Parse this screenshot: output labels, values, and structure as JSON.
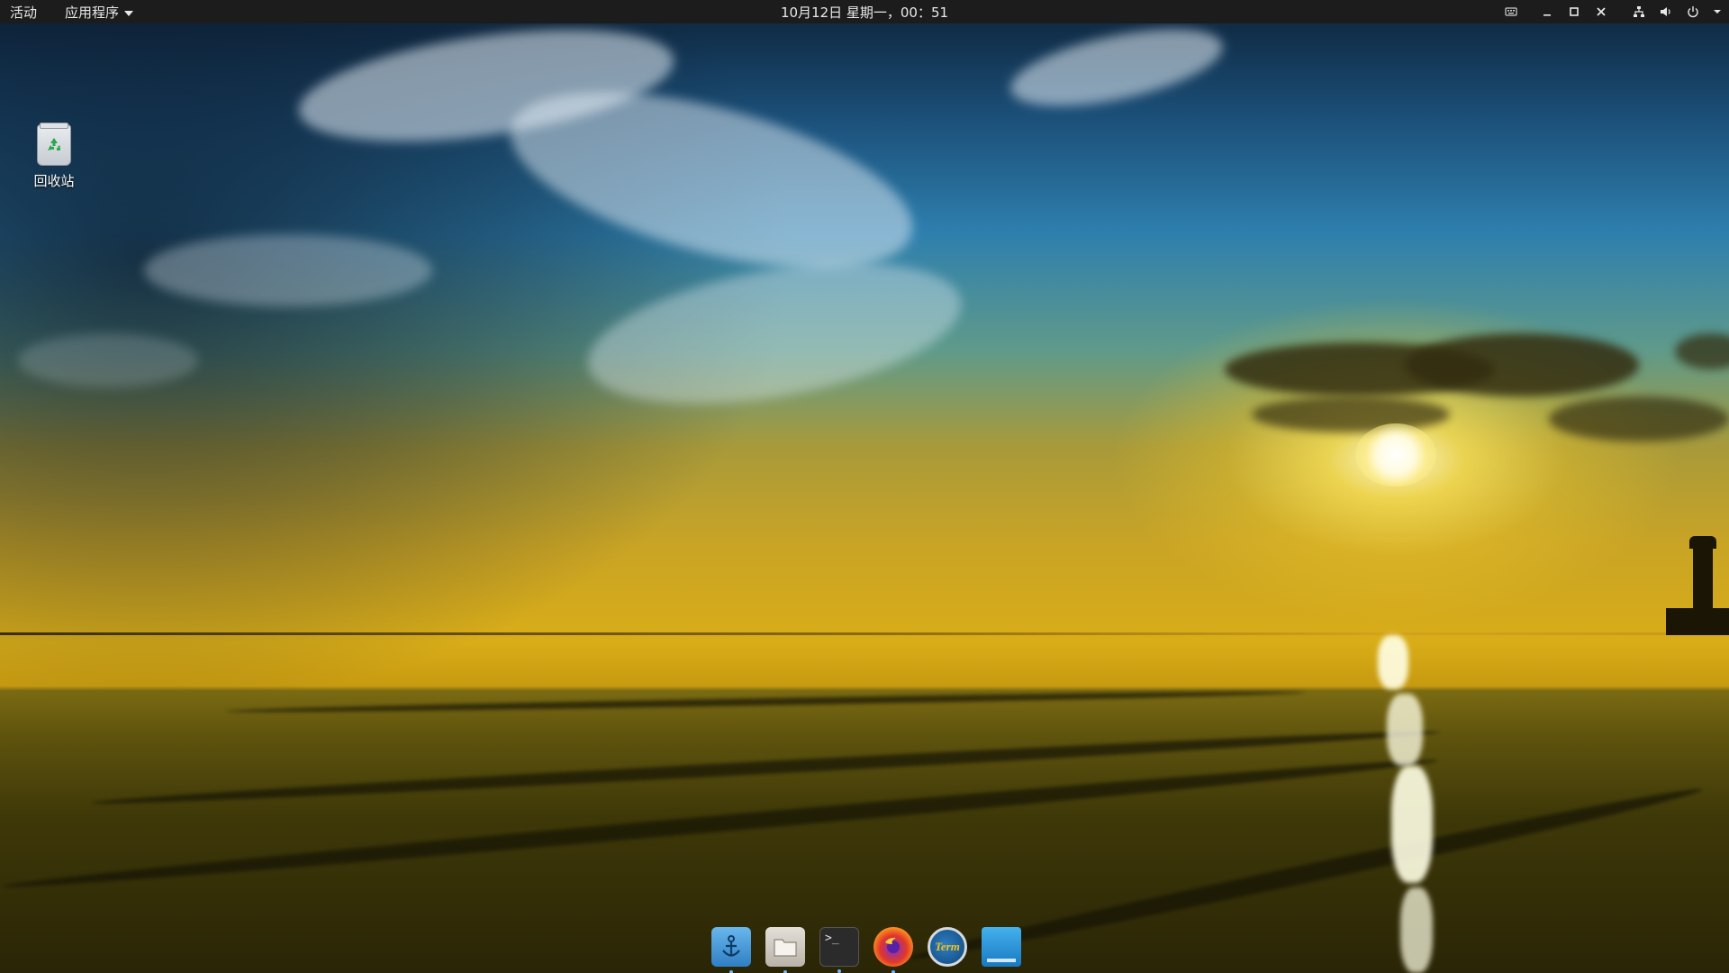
{
  "topbar": {
    "activities_label": "活动",
    "apps_menu_label": "应用程序",
    "clock_text": "10月12日 星期一，00：51",
    "tray_icons": [
      "keyboard-indicator-icon",
      "minimize-icon",
      "maximize-icon",
      "close-icon",
      "network-icon",
      "volume-icon",
      "power-icon",
      "chevron-down-icon"
    ]
  },
  "desktop_icons": [
    {
      "label": "回收站",
      "icon": "recycle-bin-icon"
    }
  ],
  "dock": {
    "items": [
      {
        "name": "anchor-app-icon",
        "running": true
      },
      {
        "name": "files-icon",
        "running": true
      },
      {
        "name": "terminal-icon",
        "running": true,
        "glyph": ">_"
      },
      {
        "name": "firefox-icon",
        "running": true
      },
      {
        "name": "term-app-icon",
        "running": false,
        "glyph": "Term"
      },
      {
        "name": "screen-app-icon",
        "running": false
      }
    ]
  },
  "colors": {
    "topbar_bg": "#1c1c1c",
    "topbar_text": "#e8e8e8",
    "running_indicator": "#6fb8ff"
  }
}
